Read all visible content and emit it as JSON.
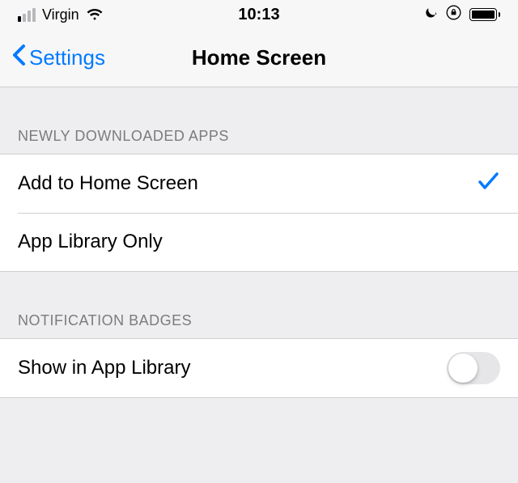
{
  "statusBar": {
    "carrier": "Virgin",
    "time": "10:13"
  },
  "nav": {
    "backLabel": "Settings",
    "title": "Home Screen"
  },
  "sections": {
    "downloaded": {
      "header": "NEWLY DOWNLOADED APPS",
      "option1": "Add to Home Screen",
      "option2": "App Library Only",
      "selected": "option1"
    },
    "badges": {
      "header": "NOTIFICATION BADGES",
      "label": "Show in App Library",
      "enabled": false
    }
  }
}
